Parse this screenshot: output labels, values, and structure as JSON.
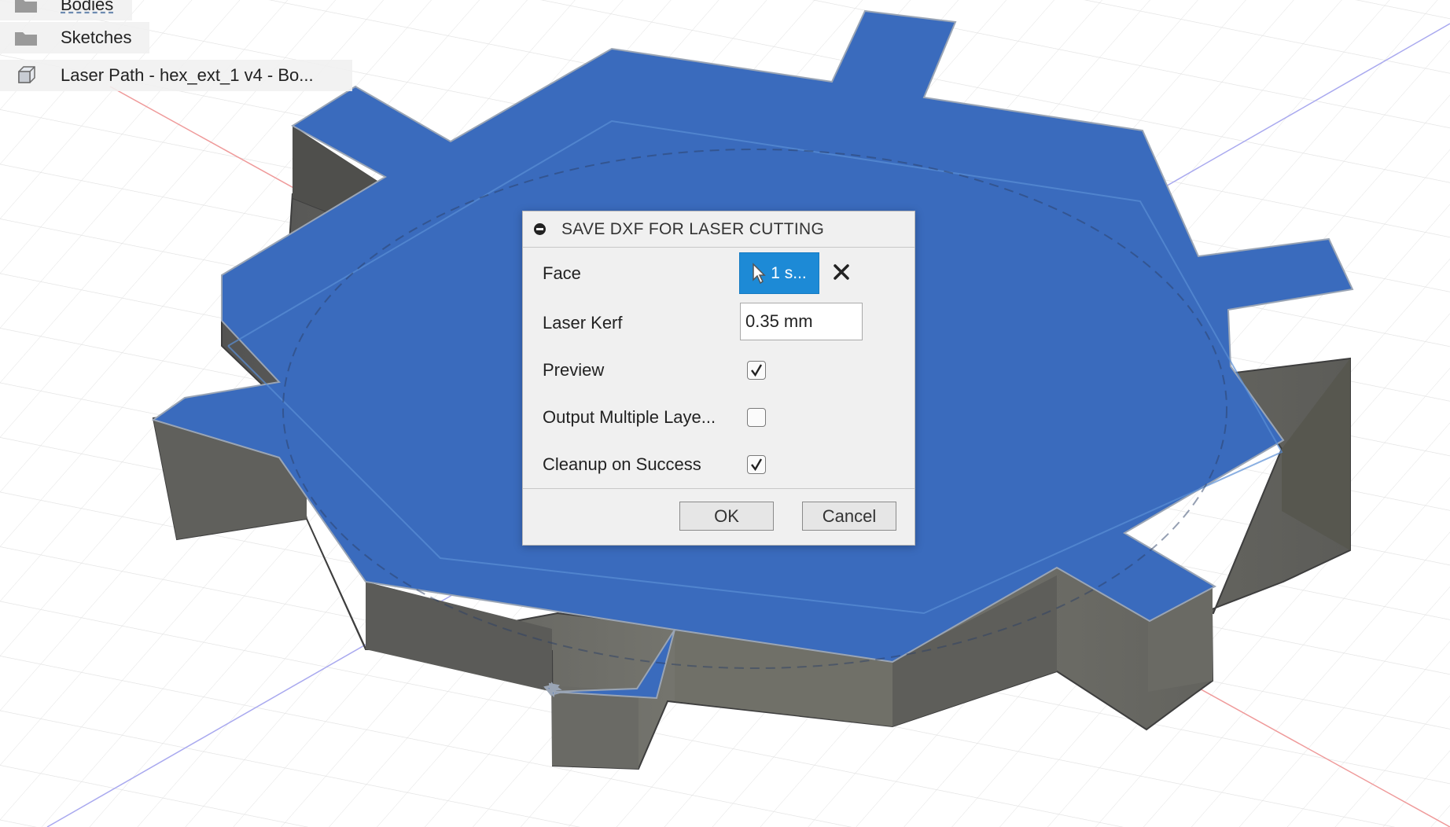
{
  "browser": {
    "items": [
      {
        "label": "Bodies",
        "icon": "folder-icon"
      },
      {
        "label": "Sketches",
        "icon": "folder-icon"
      },
      {
        "label": "Laser Path - hex_ext_1 v4 - Bo...",
        "icon": "body-icon"
      }
    ]
  },
  "dialog": {
    "title": "SAVE DXF FOR LASER CUTTING",
    "face": {
      "label": "Face",
      "selection": "1 s...",
      "clear_icon": "close-icon"
    },
    "kerf": {
      "label": "Laser Kerf",
      "value": "0.35 mm"
    },
    "preview": {
      "label": "Preview",
      "checked": true
    },
    "multiple_layers": {
      "label": "Output Multiple Laye...",
      "checked": false
    },
    "cleanup": {
      "label": "Cleanup on Success",
      "checked": true
    },
    "ok_label": "OK",
    "cancel_label": "Cancel"
  },
  "colors": {
    "face_blue": "#3a6bbd",
    "side_gray": "#6b6b6b",
    "selection_blue": "#1d8ad6",
    "axis_red": "#e87a7a",
    "axis_blue": "#8a8ae8"
  }
}
